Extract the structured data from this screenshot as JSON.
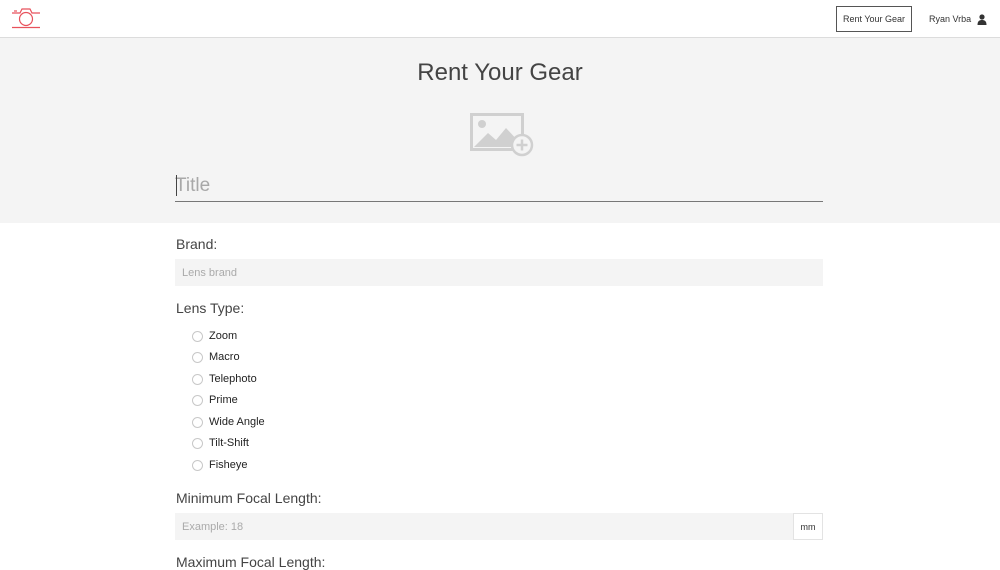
{
  "navbar": {
    "logo_icon": "camera-icon",
    "cta_label": "Rent Your Gear",
    "user_name": "Ryan Vrba",
    "user_icon": "user-icon"
  },
  "hero": {
    "title": "Rent Your Gear",
    "image_icon": "add-image-icon",
    "title_placeholder": "Title"
  },
  "form": {
    "brand_label": "Brand:",
    "brand_placeholder": "Lens brand",
    "lens_type_label": "Lens Type:",
    "lens_types": [
      "Zoom",
      "Macro",
      "Telephoto",
      "Prime",
      "Wide Angle",
      "Tilt-Shift",
      "Fisheye"
    ],
    "min_focal_label": "Minimum Focal Length:",
    "min_focal_placeholder": "Example: 18",
    "min_focal_unit": "mm",
    "max_focal_label": "Maximum Focal Length:"
  },
  "colors": {
    "brand_accent": "#e8525c",
    "header_band": "#f4f4f4"
  }
}
